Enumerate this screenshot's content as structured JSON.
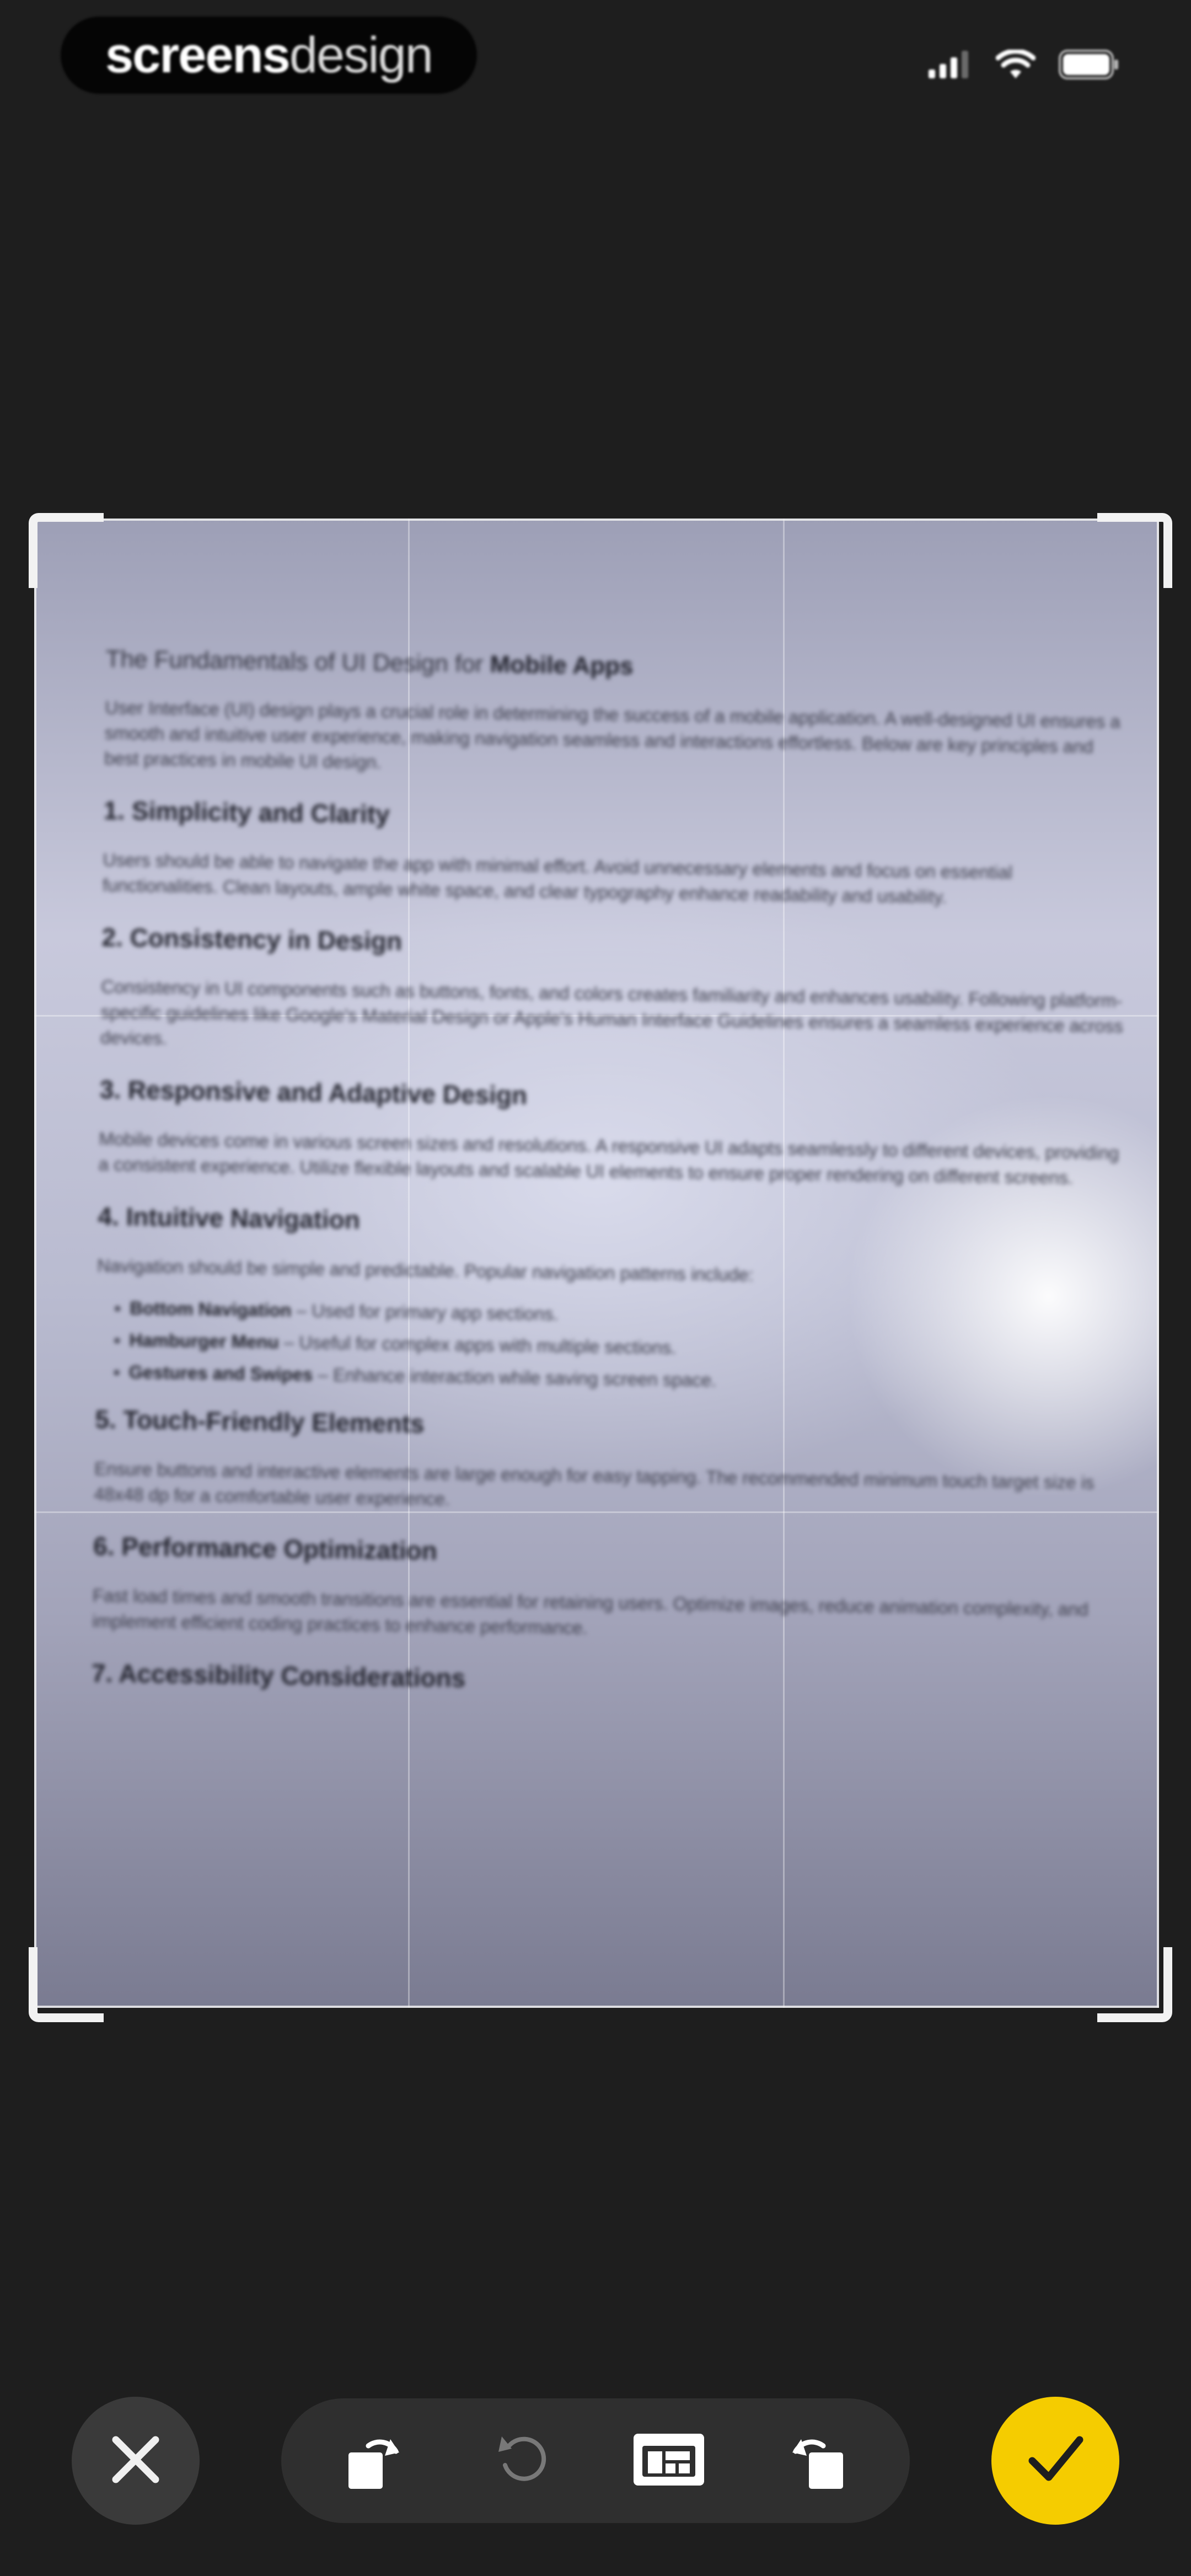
{
  "status_bar": {
    "brand_bold": "screens",
    "brand_light": "design",
    "icons": [
      "cellular-signal-icon",
      "wifi-icon",
      "battery-icon"
    ]
  },
  "document": {
    "title_prefix": "The Fundamentals of UI Design for",
    "title_bold": "Mobile Apps",
    "intro": "User Interface (UI) design plays a crucial role in determining the success of a mobile application. A well-designed UI ensures a smooth and intuitive user experience, making navigation seamless and interactions effortless. Below are key principles and best practices in mobile UI design.",
    "sections": [
      {
        "heading": "1. Simplicity and Clarity",
        "body": "Users should be able to navigate the app with minimal effort. Avoid unnecessary elements and focus on essential functionalities. Clean layouts, ample white space, and clear typography enhance readability and usability."
      },
      {
        "heading": "2. Consistency in Design",
        "body": "Consistency in UI components such as buttons, fonts, and colors creates familiarity and enhances usability. Following platform-specific guidelines like Google's Material Design or Apple's Human Interface Guidelines ensures a seamless experience across devices."
      },
      {
        "heading": "3. Responsive and Adaptive Design",
        "body": "Mobile devices come in various screen sizes and resolutions. A responsive UI adapts seamlessly to different devices, providing a consistent experience. Utilize flexible layouts and scalable UI elements to ensure proper rendering on different screens."
      },
      {
        "heading": "4. Intuitive Navigation",
        "body": "Navigation should be simple and predictable. Popular navigation patterns include:"
      }
    ],
    "bullets": [
      {
        "bold": "Bottom Navigation",
        "text": " – Used for primary app sections."
      },
      {
        "bold": "Hamburger Menu",
        "text": " – Useful for complex apps with multiple sections."
      },
      {
        "bold": "Gestures and Swipes",
        "text": " – Enhance interaction while saving screen space."
      }
    ],
    "sections_after": [
      {
        "heading": "5. Touch-Friendly Elements",
        "body": "Ensure buttons and interactive elements are large enough for easy tapping. The recommended minimum touch target size is 48x48 dp for a comfortable user experience."
      },
      {
        "heading": "6. Performance Optimization",
        "body": "Fast load times and smooth transitions are essential for retaining users. Optimize images, reduce animation complexity, and implement efficient coding practices to enhance performance."
      },
      {
        "heading": "7. Accessibility Considerations",
        "body": ""
      }
    ]
  },
  "toolbar": {
    "close_icon": "close-icon",
    "tools": [
      "rotate-left-icon",
      "undo-icon",
      "filter-icon",
      "rotate-right-icon"
    ],
    "confirm_icon": "checkmark-icon",
    "colors": {
      "confirm": "#f5cc00",
      "close_bg": "#3a3a3a",
      "pill_bg": "#2f2f2f"
    }
  }
}
